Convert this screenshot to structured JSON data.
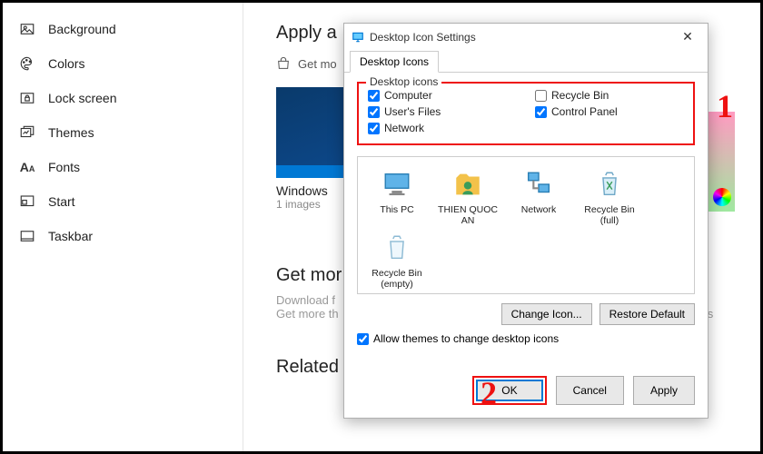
{
  "sidebar": {
    "items": [
      {
        "label": "Background",
        "icon": "picture-icon"
      },
      {
        "label": "Colors",
        "icon": "palette-icon"
      },
      {
        "label": "Lock screen",
        "icon": "lock-icon"
      },
      {
        "label": "Themes",
        "icon": "themes-icon"
      },
      {
        "label": "Fonts",
        "icon": "fonts-icon"
      },
      {
        "label": "Start",
        "icon": "start-icon"
      },
      {
        "label": "Taskbar",
        "icon": "taskbar-icon"
      }
    ]
  },
  "main": {
    "apply_heading": "Apply a",
    "store_prefix": "Get mo",
    "theme": {
      "name": "Windows",
      "sub": "1 images"
    },
    "getmore_heading": "Get mor",
    "getmore_line1": "Download f",
    "getmore_line2_a": "Get more th",
    "getmore_line2_b": "unds, and colors",
    "related_heading": "Related Settings"
  },
  "dialog": {
    "title": "Desktop Icon Settings",
    "tab": "Desktop Icons",
    "fieldset_label": "Desktop icons",
    "checks": {
      "computer": {
        "label": "Computer",
        "checked": true
      },
      "recycle": {
        "label": "Recycle Bin",
        "checked": false
      },
      "users": {
        "label": "User's Files",
        "checked": true
      },
      "control": {
        "label": "Control Panel",
        "checked": true
      },
      "network": {
        "label": "Network",
        "checked": true
      }
    },
    "icons": [
      {
        "label": "This PC",
        "kind": "pc"
      },
      {
        "label": "THIEN QUOC AN",
        "kind": "user"
      },
      {
        "label": "Network",
        "kind": "net"
      },
      {
        "label": "Recycle Bin (full)",
        "kind": "bin-full"
      },
      {
        "label": "Recycle Bin (empty)",
        "kind": "bin-empty"
      }
    ],
    "change_icon": "Change Icon...",
    "restore_default": "Restore Default",
    "allow": {
      "label": "Allow themes to change desktop icons",
      "checked": true
    },
    "ok": "OK",
    "cancel": "Cancel",
    "apply": "Apply"
  },
  "annotations": {
    "one": "1",
    "two": "2"
  }
}
